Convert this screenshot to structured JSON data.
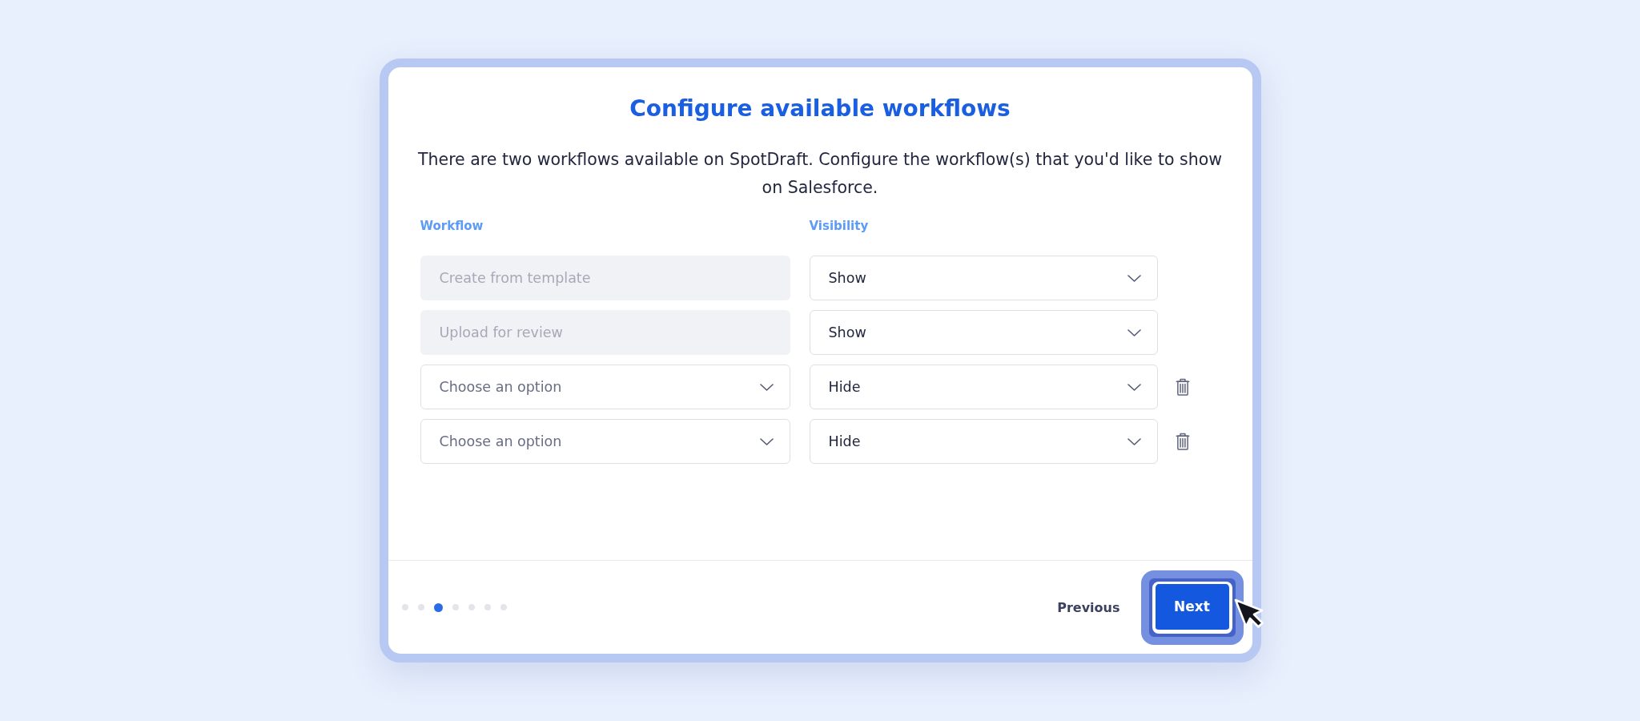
{
  "dialog": {
    "title": "Configure available workflows",
    "description": "There are two workflows available on SpotDraft. Configure the workflow(s) that you'd like to show on Salesforce.",
    "columns": [
      "Workflow",
      "Visibility"
    ],
    "rows": [
      {
        "workflow": {
          "kind": "text",
          "value": "Create from template"
        },
        "visibility": {
          "value": "Show"
        },
        "deletable": false
      },
      {
        "workflow": {
          "kind": "text",
          "value": "Upload for review"
        },
        "visibility": {
          "value": "Show"
        },
        "deletable": false
      },
      {
        "workflow": {
          "kind": "select",
          "placeholder": "Choose an option"
        },
        "visibility": {
          "value": "Hide"
        },
        "deletable": true
      },
      {
        "workflow": {
          "kind": "select",
          "placeholder": "Choose an option"
        },
        "visibility": {
          "value": "Hide"
        },
        "deletable": true
      }
    ],
    "steps": [
      {
        "selected": false
      },
      {
        "selected": false
      },
      {
        "selected": true
      },
      {
        "selected": false
      },
      {
        "selected": false
      },
      {
        "selected": false
      },
      {
        "selected": false
      }
    ],
    "buttons": [
      {
        "label": "Previous",
        "kind": "text",
        "highlighted": false
      },
      {
        "label": "Next",
        "kind": "primary",
        "highlighted": true
      }
    ]
  }
}
